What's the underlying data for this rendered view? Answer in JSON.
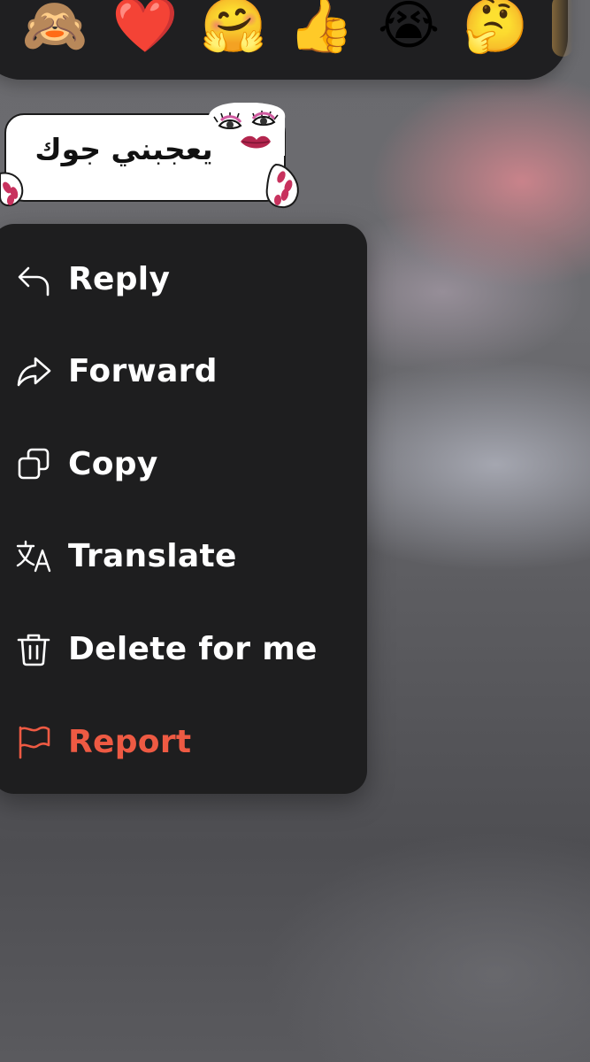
{
  "reactions": [
    {
      "name": "see-no-evil-monkey",
      "glyph": "🙈"
    },
    {
      "name": "red-heart",
      "glyph": "❤️"
    },
    {
      "name": "hugging-face",
      "glyph": "🤗"
    },
    {
      "name": "thumbs-up",
      "glyph": "👍"
    },
    {
      "name": "loudly-crying-face",
      "glyph": "😭"
    },
    {
      "name": "thinking-face",
      "glyph": "🤔"
    }
  ],
  "message": {
    "sticker_text": "يعجبني جوك"
  },
  "menu": {
    "items": [
      {
        "label": "Reply",
        "icon": "reply-icon"
      },
      {
        "label": "Forward",
        "icon": "forward-icon"
      },
      {
        "label": "Copy",
        "icon": "copy-icon"
      },
      {
        "label": "Translate",
        "icon": "translate-icon"
      },
      {
        "label": "Delete for me",
        "icon": "trash-icon"
      },
      {
        "label": "Report",
        "icon": "flag-icon",
        "color": "#ee5a43"
      }
    ]
  },
  "colors": {
    "menu_background": "#1e1e1f",
    "menu_text": "#ffffff",
    "danger": "#ee5a43",
    "reaction_bar": "#1f1f21"
  }
}
